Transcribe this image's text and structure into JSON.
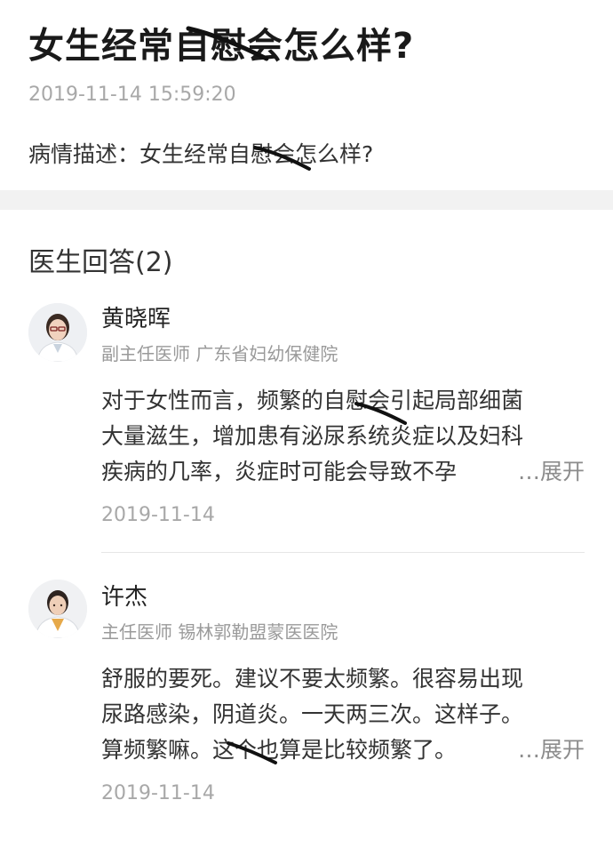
{
  "question": {
    "title": "女生经常自慰会怎么样?",
    "datetime": "2019-11-14 15:59:20",
    "description": "病情描述：女生经常自慰会怎么样?"
  },
  "answers_header": "医生回答(2)",
  "answers": [
    {
      "doctor_name": "黄晓晖",
      "doctor_meta": "副主任医师 广东省妇幼保健院",
      "text_lines": [
        "对于女性而言，频繁的自慰会引起局部细菌",
        "大量滋生，增加患有泌尿系统炎症以及妇科",
        "疾病的几率，炎症时可能会导致不孕"
      ],
      "expand_label": "…展开",
      "date": "2019-11-14"
    },
    {
      "doctor_name": "许杰",
      "doctor_meta": "主任医师 锡林郭勒盟蒙医医院",
      "text_lines": [
        "舒服的要死。建议不要太频繁。很容易出现",
        "尿路感染，阴道炎。一天两三次。这样子。",
        "算频繁嘛。这个也算是比较频繁了。"
      ],
      "expand_label": "…展开",
      "date": "2019-11-14"
    }
  ],
  "colors": {
    "divider_band": "#f2f2f2",
    "muted_text": "#a8a8a8",
    "meta_text": "#9a9a9a",
    "scribble": "#111111"
  }
}
